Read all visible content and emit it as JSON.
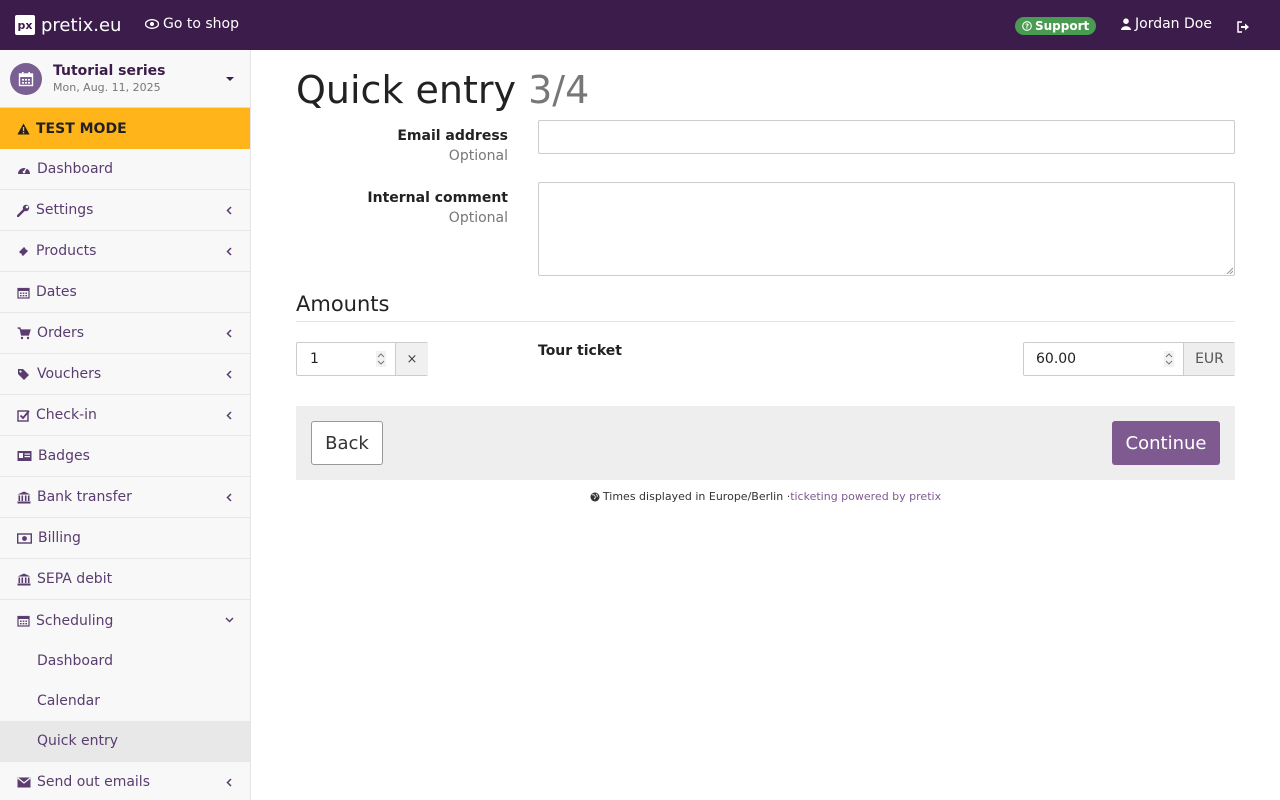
{
  "topbar": {
    "logo_mark": "px",
    "brand": "pretix.eu",
    "go_to_shop": "Go to shop",
    "support": "Support",
    "user": "Jordan Doe"
  },
  "sidebar": {
    "event": {
      "name": "Tutorial series",
      "date": "Mon, Aug. 11, 2025"
    },
    "test_mode": "TEST MODE",
    "items": [
      {
        "label": "Dashboard",
        "icon": "dashboard-icon"
      },
      {
        "label": "Settings",
        "icon": "wrench-icon"
      },
      {
        "label": "Products",
        "icon": "ticket-icon"
      },
      {
        "label": "Dates",
        "icon": "calendar-icon"
      },
      {
        "label": "Orders",
        "icon": "cart-icon"
      },
      {
        "label": "Vouchers",
        "icon": "tags-icon"
      },
      {
        "label": "Check-in",
        "icon": "check-square-icon"
      },
      {
        "label": "Badges",
        "icon": "id-card-icon"
      },
      {
        "label": "Bank transfer",
        "icon": "bank-icon"
      },
      {
        "label": "Billing",
        "icon": "money-icon"
      },
      {
        "label": "SEPA debit",
        "icon": "bank-icon"
      },
      {
        "label": "Scheduling",
        "icon": "calendar-icon"
      }
    ],
    "scheduling_sub": [
      "Dashboard",
      "Calendar",
      "Quick entry"
    ],
    "send_emails": "Send out emails"
  },
  "main": {
    "title": "Quick entry",
    "step": "3/4",
    "email_label": "Email address",
    "email_optional": "Optional",
    "email_value": "",
    "comment_label": "Internal comment",
    "comment_optional": "Optional",
    "comment_value": "",
    "amounts_heading": "Amounts",
    "quantity": "1",
    "remove_symbol": "×",
    "product_name": "Tour ticket",
    "price": "60.00",
    "currency": "EUR",
    "back_label": "Back",
    "continue_label": "Continue"
  },
  "footer": {
    "timezone_text": "Times displayed in Europe/Berlin · ",
    "powered_link": "ticketing powered by pretix"
  },
  "colors": {
    "topbar": "#3b1c4a",
    "accent": "#7f5a91",
    "test_mode": "#ffb419",
    "support_badge": "#4a9b52"
  }
}
